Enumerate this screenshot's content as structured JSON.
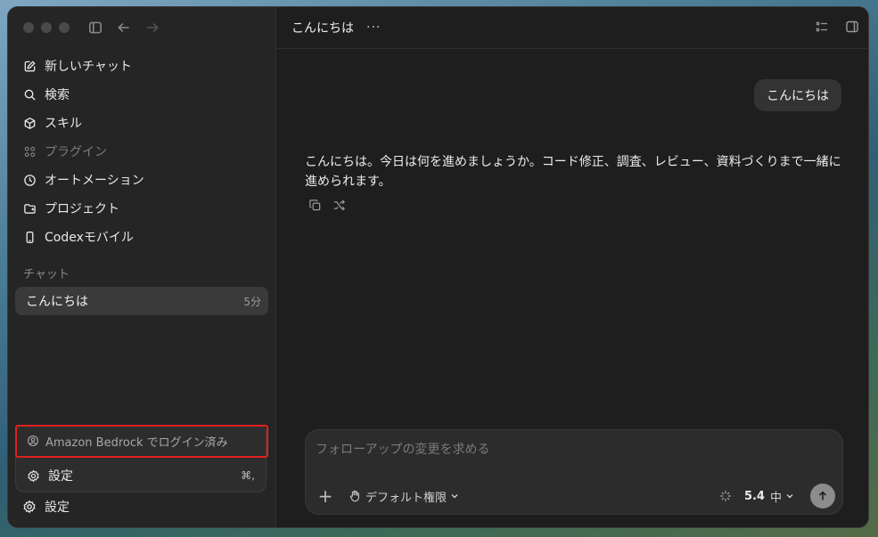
{
  "sidebar": {
    "items": [
      {
        "label": "新しいチャット",
        "icon": "edit-icon",
        "dim": false
      },
      {
        "label": "検索",
        "icon": "search-icon",
        "dim": false
      },
      {
        "label": "スキル",
        "icon": "cube-icon",
        "dim": false
      },
      {
        "label": "プラグイン",
        "icon": "grid-icon",
        "dim": true
      },
      {
        "label": "オートメーション",
        "icon": "clock-icon",
        "dim": false
      },
      {
        "label": "プロジェクト",
        "icon": "folder-icon",
        "dim": false
      },
      {
        "label": "Codexモバイル",
        "icon": "phone-icon",
        "dim": false
      }
    ],
    "section_label": "チャット",
    "chats": [
      {
        "title": "こんにちは",
        "time": "5分"
      }
    ],
    "popup": {
      "login_status": "Amazon Bedrock でログイン済み",
      "settings_label": "設定",
      "settings_shortcut": "⌘,"
    },
    "settings_label": "設定"
  },
  "main": {
    "title": "こんにちは",
    "more": "···",
    "user_message": "こんにちは",
    "assistant_message": "こんにちは。今日は何を進めましょうか。コード修正、調査、レビュー、資料づくりまで一緒に進められます。",
    "composer": {
      "placeholder": "フォローアップの変更を求める",
      "value": "",
      "permission_label": "デフォルト権限",
      "model": "5.4",
      "effort": "中"
    }
  },
  "colors": {
    "highlight": "#e02020",
    "window_bg": "#1f1f1f",
    "sidebar_bg": "#252525"
  }
}
